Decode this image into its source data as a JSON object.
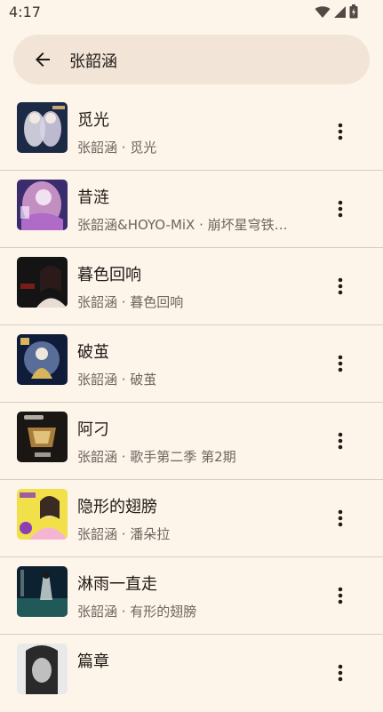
{
  "status_bar": {
    "time": "4:17",
    "icons": [
      "wifi-icon",
      "signal-icon",
      "battery-icon"
    ]
  },
  "search": {
    "query": "张韶涵",
    "back_icon": "arrow-back-icon"
  },
  "songs": [
    {
      "title": "觅光",
      "subtitle": "张韶涵 · 觅光",
      "cover_colors": [
        "#1c2a45",
        "#e8e4ee",
        "#c8a676"
      ]
    },
    {
      "title": "昔涟",
      "subtitle": "张韶涵&HOYO-MiX · 崩坏星穹铁…",
      "cover_colors": [
        "#3a2d6e",
        "#e6a7d8",
        "#f2e1f0"
      ]
    },
    {
      "title": "暮色回响",
      "subtitle": "张韶涵 · 暮色回响",
      "cover_colors": [
        "#141414",
        "#7a1c1c",
        "#e7ddd4"
      ]
    },
    {
      "title": "破茧",
      "subtitle": "张韶涵 · 破茧",
      "cover_colors": [
        "#0f1d3a",
        "#d8b45a",
        "#8aa3d8"
      ]
    },
    {
      "title": "阿刁",
      "subtitle": "张韶涵 · 歌手第二季 第2期",
      "cover_colors": [
        "#1a1614",
        "#a87d3c",
        "#e0c27a"
      ]
    },
    {
      "title": "隐形的翅膀",
      "subtitle": "张韶涵 · 潘朵拉",
      "cover_colors": [
        "#f1e04a",
        "#8a3fb5",
        "#f6b4d2"
      ]
    },
    {
      "title": "淋雨一直走",
      "subtitle": "张韶涵 · 有形的翅膀",
      "cover_colors": [
        "#0d2230",
        "#2b6f6a",
        "#c9d6d4"
      ]
    },
    {
      "title": "篇章",
      "subtitle": "",
      "cover_colors": [
        "#e9e9e9",
        "#2a2a2a",
        "#bfbfbf"
      ]
    }
  ],
  "more_icon": "more-vert-icon"
}
